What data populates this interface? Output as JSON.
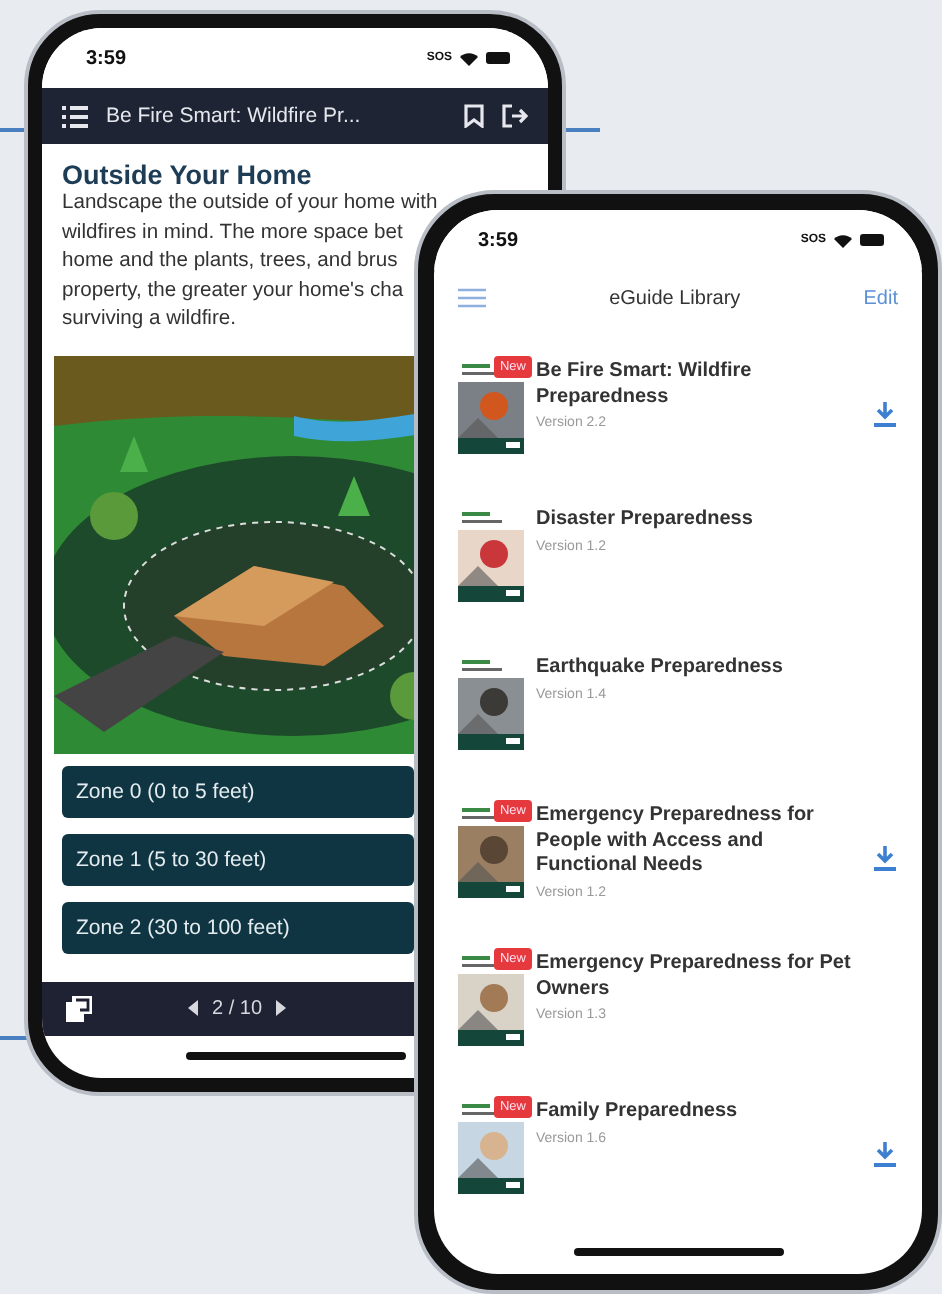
{
  "reader_phone": {
    "status_bar": {
      "time": "3:59",
      "carrier": "SOS"
    },
    "header": {
      "title": "Be Fire Smart: Wildfire Pr..."
    },
    "article": {
      "heading": "Outside Your Home",
      "paragraph_lines": [
        "Landscape the outside of your home with",
        "wildfires in mind. The more space bet",
        "home and the plants, trees, and brus",
        "property, the greater your home's cha",
        "surviving a wildfire."
      ]
    },
    "zone_buttons": [
      "Zone 0 (0 to 5 feet)",
      "Zone 1 (5 to 30 feet)",
      "Zone 2 (30 to 100 feet)"
    ],
    "pager": {
      "page": "2 / 10"
    }
  },
  "library_phone": {
    "status_bar": {
      "time": "3:59",
      "carrier": "SOS"
    },
    "header": {
      "title": "eGuide Library",
      "edit": "Edit"
    },
    "guides": [
      {
        "title": "Be Fire Smart: Wildfire Preparedness",
        "version": "Version 2.2",
        "badge": "New",
        "downloadable": true
      },
      {
        "title": "Disaster Preparedness",
        "version": "Version 1.2",
        "downloadable": false
      },
      {
        "title": "Earthquake Preparedness",
        "version": "Version 1.4",
        "downloadable": false
      },
      {
        "title": "Emergency Preparedness for People with Access and Functional Needs",
        "version": "Version 1.2",
        "badge": "New",
        "downloadable": true
      },
      {
        "title": "Emergency Preparedness for Pet Owners",
        "version": "Version 1.3",
        "badge": "New",
        "downloadable": false
      },
      {
        "title": "Family Preparedness",
        "version": "Version 1.6",
        "badge": "New",
        "downloadable": true
      }
    ]
  }
}
